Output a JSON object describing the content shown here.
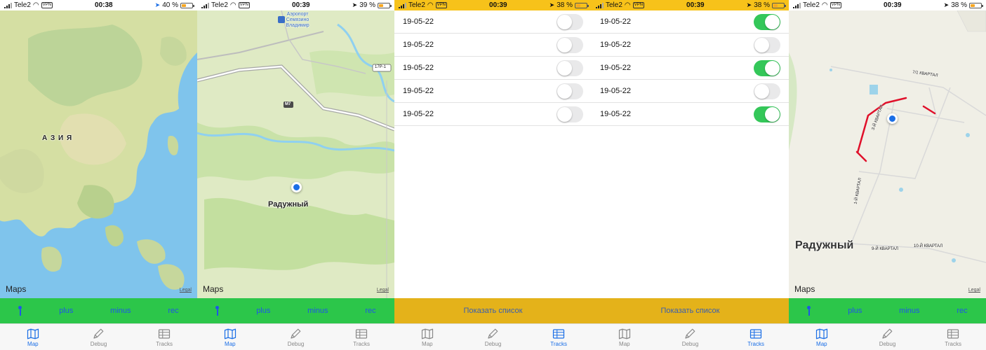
{
  "screens": [
    {
      "statusbar": {
        "carrier": "Tele2",
        "vpn": "VPN",
        "time": "00:38",
        "battery": "40 %"
      },
      "map": {
        "region_label": "А З И Я",
        "maps_brand": "Maps",
        "legal": "Legal"
      },
      "actions": {
        "plus": "plus",
        "minus": "minus",
        "rec": "rec"
      },
      "tabs": {
        "map": "Map",
        "debug": "Debug",
        "tracks": "Tracks"
      }
    },
    {
      "statusbar": {
        "carrier": "Tele2",
        "vpn": "VPN",
        "time": "00:39",
        "battery": "39 %"
      },
      "map": {
        "airport_label": "Аэропорт Семязино Владимир",
        "road_m7": "M7",
        "road_17r1": "17Р-1",
        "city_label": "Радужный",
        "maps_brand": "Maps",
        "legal": "Legal"
      },
      "actions": {
        "plus": "plus",
        "minus": "minus",
        "rec": "rec"
      },
      "tabs": {
        "map": "Map",
        "debug": "Debug",
        "tracks": "Tracks"
      }
    },
    {
      "statusbar": {
        "carrier": "Tele2",
        "vpn": "VPN",
        "time": "00:39",
        "battery": "38 %"
      },
      "tracks": [
        {
          "date": "19-05-22",
          "enabled": false
        },
        {
          "date": "19-05-22",
          "enabled": false
        },
        {
          "date": "19-05-22",
          "enabled": false
        },
        {
          "date": "19-05-22",
          "enabled": false
        },
        {
          "date": "19-05-22",
          "enabled": false
        }
      ],
      "show_list": "Показать список",
      "tabs": {
        "map": "Map",
        "debug": "Debug",
        "tracks": "Tracks"
      }
    },
    {
      "statusbar": {
        "carrier": "Tele2",
        "vpn": "VPN",
        "time": "00:39",
        "battery": "38 %"
      },
      "tracks": [
        {
          "date": "19-05-22",
          "enabled": true
        },
        {
          "date": "19-05-22",
          "enabled": false
        },
        {
          "date": "19-05-22",
          "enabled": true
        },
        {
          "date": "19-05-22",
          "enabled": false
        },
        {
          "date": "19-05-22",
          "enabled": true
        }
      ],
      "show_list": "Показать список",
      "tabs": {
        "map": "Map",
        "debug": "Debug",
        "tracks": "Tracks"
      }
    },
    {
      "statusbar": {
        "carrier": "Tele2",
        "vpn": "VPN",
        "time": "00:39",
        "battery": "38 %"
      },
      "map": {
        "city_label": "Радужный",
        "street_labels": [
          "7/1 КВАРТАЛ",
          "3-Й КВАРТАЛ",
          "1-Й КВАРТАЛ",
          "9-Й КВАРТАЛ",
          "10-Й КВАРТАЛ"
        ],
        "maps_brand": "Maps",
        "legal": "Legal"
      },
      "actions": {
        "plus": "plus",
        "minus": "minus",
        "rec": "rec"
      },
      "tabs": {
        "map": "Map",
        "debug": "Debug",
        "tracks": "Tracks"
      }
    }
  ],
  "colors": {
    "action_green": "#2cc64a",
    "tracks_yellow": "#e4b21a",
    "status_yellow": "#f7c21a",
    "tab_active": "#1a6ee6",
    "track_red": "#e0102a"
  }
}
